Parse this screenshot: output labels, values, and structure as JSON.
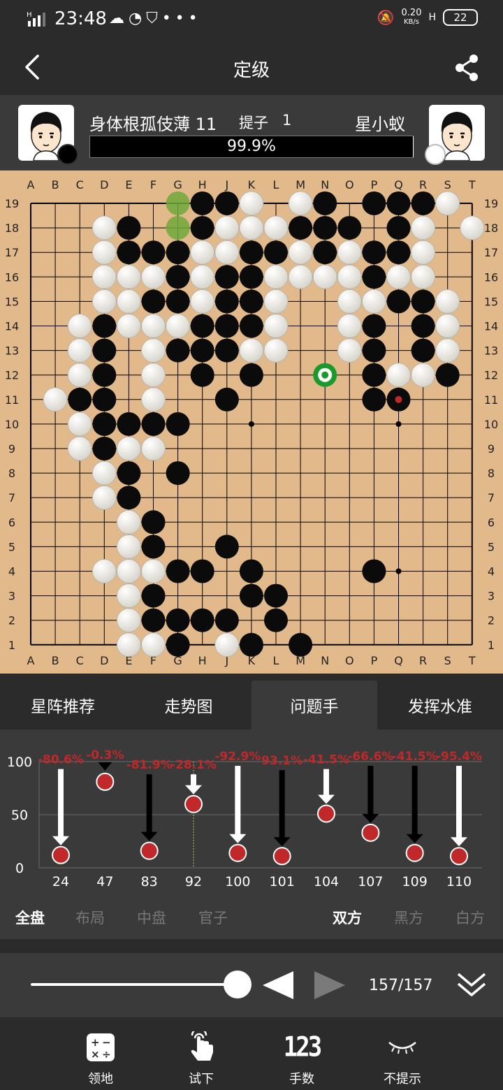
{
  "status_bar": {
    "time": "23:48",
    "network_speed": "0.20",
    "network_unit": "KB/s",
    "battery": "22"
  },
  "header": {
    "title": "定级"
  },
  "players": {
    "black_name": "身体根孤伎薄 11",
    "capture_label": "提子",
    "capture_count": "1",
    "white_name": "星小蚁",
    "winrate_text": "99.9%",
    "black_winrate": 0.999
  },
  "board": {
    "columns": [
      "A",
      "B",
      "C",
      "D",
      "E",
      "F",
      "G",
      "H",
      "J",
      "K",
      "L",
      "M",
      "N",
      "O",
      "P",
      "Q",
      "R",
      "S",
      "T"
    ],
    "rows": [
      "19",
      "18",
      "17",
      "16",
      "15",
      "14",
      "13",
      "12",
      "11",
      "10",
      "9",
      "8",
      "7",
      "6",
      "5",
      "4",
      "3",
      "2",
      "1"
    ],
    "grid": [
      "......_BBW.WB.BBBW.",
      "...WB._BWWWBBB.BW.W",
      "...WBBBWWBBWBWBBW..",
      "...WWWBWBBWWWWBWW..",
      "...WWBBWBBW..WWBBW.",
      "..WBWWWBBBW..WB.BW.",
      "..WB.WBBBWW..WB.BW.",
      "..WB.W.B.B..G.BWWB.",
      ".WBB.W..B.....Bm...",
      "..WBBBB............",
      "..WBWW.............",
      "...WB.B............",
      "...WB..............",
      "....WB.............",
      "....WB..B..........",
      "...WWWBB.B....B....",
      "....WB...BB........",
      "....WBBBB.B........",
      "....WWB.WB.B......."
    ],
    "legend": "B=black, W=white, .=empty, _=green hint, G=green ring marker, m=black with red last-move marker"
  },
  "tabs": [
    {
      "label": "星阵推荐",
      "active": false
    },
    {
      "label": "走势图",
      "active": false
    },
    {
      "label": "问题手",
      "active": true
    },
    {
      "label": "发挥水准",
      "active": false
    }
  ],
  "chart_data": {
    "type": "scatter",
    "y_ticks": [
      "100",
      "50",
      "0"
    ],
    "ylim": [
      0,
      100
    ],
    "points": [
      {
        "move": "24",
        "change": "-80.6%",
        "from": 93,
        "to": 12,
        "color": "white"
      },
      {
        "move": "47",
        "change": "-0.3%",
        "from": 81,
        "to": 81,
        "color": "black"
      },
      {
        "move": "83",
        "change": "-81.9%",
        "from": 88,
        "to": 16,
        "color": "black"
      },
      {
        "move": "92",
        "change": "-28.1%",
        "from": 88,
        "to": 60,
        "color": "white"
      },
      {
        "move": "100",
        "change": "-92.9%",
        "from": 96,
        "to": 14,
        "color": "white"
      },
      {
        "move": "101",
        "change": "93.1%",
        "from": 92,
        "to": 11,
        "color": "black"
      },
      {
        "move": "104",
        "change": "-41.5%",
        "from": 93,
        "to": 51,
        "color": "white"
      },
      {
        "move": "107",
        "change": "-66.6%",
        "from": 96,
        "to": 33,
        "color": "black"
      },
      {
        "move": "109",
        "change": "-41.5%",
        "from": 96,
        "to": 14,
        "color": "black"
      },
      {
        "move": "110",
        "change": "-95.4%",
        "from": 96,
        "to": 11,
        "color": "white"
      }
    ]
  },
  "filters_left": [
    {
      "label": "全盘",
      "active": true
    },
    {
      "label": "布局",
      "active": false
    },
    {
      "label": "中盘",
      "active": false
    },
    {
      "label": "官子",
      "active": false
    }
  ],
  "filters_right": [
    {
      "label": "双方",
      "active": true
    },
    {
      "label": "黑方",
      "active": false
    },
    {
      "label": "白方",
      "active": false
    }
  ],
  "playback": {
    "counter": "157/157",
    "progress": 1.0
  },
  "toolbar": [
    {
      "label": "领地",
      "icon": "calculator-icon"
    },
    {
      "label": "试下",
      "icon": "tap-hand-icon"
    },
    {
      "label": "手数",
      "icon": "number-123-icon"
    },
    {
      "label": "不提示",
      "icon": "closed-eye-icon"
    }
  ],
  "toolbar_number_glyph": "123",
  "colors": {
    "board": "#e2b98a",
    "line": "#000000",
    "marker_red": "#c0282a",
    "hint_green": "#6fa83a",
    "ring_green": "#1a9a2a"
  }
}
